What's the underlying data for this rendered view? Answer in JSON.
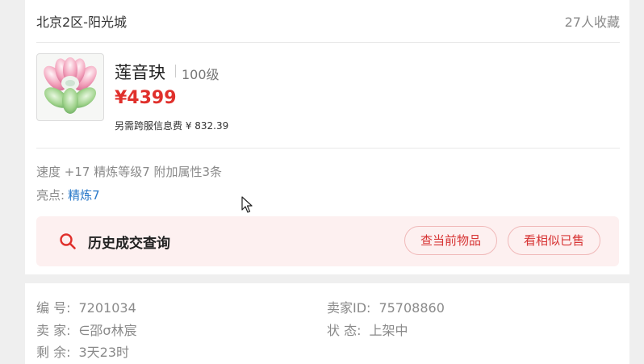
{
  "listing": {
    "server": "北京2区-阳光城",
    "favorites": "27人收藏"
  },
  "item": {
    "name": "莲音玦",
    "level": "100级",
    "price": "¥4399",
    "fee": "另需跨服信息费 ¥ 832.39",
    "icon": "lotus-jade-pendant"
  },
  "attributes": {
    "stats": "速度 +17 精炼等级7 附加属性3条",
    "highlight_label": "亮点:",
    "highlight_value": "精炼7"
  },
  "history": {
    "title": "历史成交查询",
    "check_current": "查当前物品",
    "view_similar": "看相似已售"
  },
  "details": {
    "id_label": "编 号:",
    "id_value": "7201034",
    "seller_id_label": "卖家ID:",
    "seller_id_value": "75708860",
    "seller_label": "卖 家:",
    "seller_value": "∈邵σ林宸",
    "status_label": "状 态:",
    "status_value": "上架中",
    "remaining_label": "剩 余:",
    "remaining_value": "3天23时"
  },
  "colors": {
    "price": "#e0302c",
    "link": "#2a79c9",
    "history_bg": "#fdf0f0",
    "pill_text": "#d73434"
  }
}
